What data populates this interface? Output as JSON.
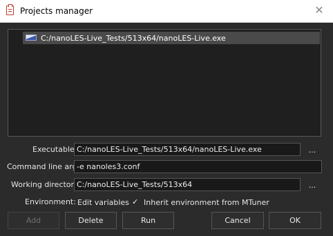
{
  "window": {
    "title": "Projects manager",
    "close_glyph": "✕",
    "icon": "clipboard-icon"
  },
  "projects": [
    {
      "path": "C:/nanoLES-Live_Tests/513x64/nanoLES-Live.exe",
      "icon": "executable-icon",
      "selected": true
    }
  ],
  "form": {
    "executable_label": "Executable",
    "executable_value": "C:/nanoLES-Live_Tests/513x64/nanoLES-Live.exe",
    "args_label": "Command line args",
    "args_value": "-e nanoles3.conf",
    "workdir_label": "Working directory",
    "workdir_value": "C:/nanoLES-Live_Tests/513x64",
    "browse_label": "...",
    "environment_label": "Environment:",
    "edit_variables_label": "Edit variables",
    "inherit_checked": true,
    "check_glyph": "✓",
    "inherit_label": "Inherit environment from MTuner"
  },
  "buttons": {
    "add": "Add",
    "delete": "Delete",
    "run": "Run",
    "cancel": "Cancel",
    "ok": "OK"
  },
  "colors": {
    "background": "#2b2b2b",
    "selection": "#4a4a4a",
    "field": "#191919",
    "title_icon": "#c0392b"
  }
}
